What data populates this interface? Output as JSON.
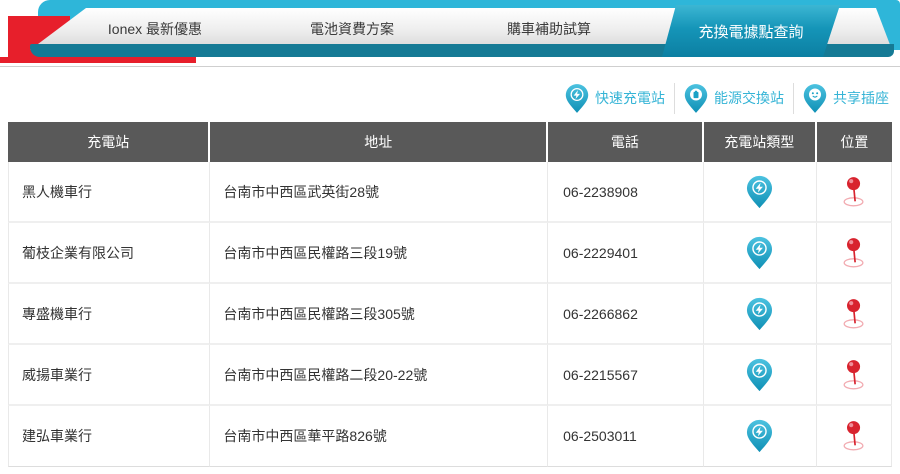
{
  "header": {
    "tabs": [
      {
        "label": "Ionex 最新優惠",
        "active": false
      },
      {
        "label": "電池資費方案",
        "active": false
      },
      {
        "label": "購車補助試算",
        "active": false
      },
      {
        "label": "充換電據點查詢",
        "active": true
      }
    ]
  },
  "legend": {
    "items": [
      {
        "label": "快速充電站",
        "icon": "fast-charge-pin-icon"
      },
      {
        "label": "能源交換站",
        "icon": "battery-swap-pin-icon"
      },
      {
        "label": "共享插座",
        "icon": "shared-socket-pin-icon"
      }
    ]
  },
  "table": {
    "headers": [
      "充電站",
      "地址",
      "電話",
      "充電站類型",
      "位置"
    ],
    "rows": [
      {
        "name": "黑人機車行",
        "address": "台南市中西區武英街28號",
        "phone": "06-2238908",
        "type_icon": "fast-charge-pin-icon",
        "location_icon": "map-pin-icon"
      },
      {
        "name": "葡枝企業有限公司",
        "address": "台南市中西區民權路三段19號",
        "phone": "06-2229401",
        "type_icon": "fast-charge-pin-icon",
        "location_icon": "map-pin-icon"
      },
      {
        "name": "專盛機車行",
        "address": "台南市中西區民權路三段305號",
        "phone": "06-2266862",
        "type_icon": "fast-charge-pin-icon",
        "location_icon": "map-pin-icon"
      },
      {
        "name": "威揚車業行",
        "address": "台南市中西區民權路二段20-22號",
        "phone": "06-2215567",
        "type_icon": "fast-charge-pin-icon",
        "location_icon": "map-pin-icon"
      },
      {
        "name": "建弘車業行",
        "address": "台南市中西區華平路826號",
        "phone": "06-2503011",
        "type_icon": "fast-charge-pin-icon",
        "location_icon": "map-pin-icon"
      }
    ]
  },
  "colors": {
    "accent_cyan": "#2eb6d9",
    "accent_teal_dark": "#157a95",
    "brand_red": "#e71f2b",
    "table_header_gray": "#595959",
    "legend_text_teal": "#35b4d6",
    "pin_teal": "#1ba2c6",
    "pin_red": "#d8232e"
  }
}
